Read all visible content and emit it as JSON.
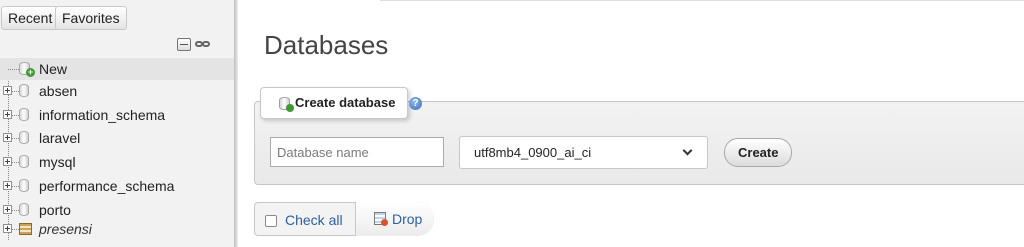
{
  "sidebar": {
    "tabs": {
      "recent": "Recent",
      "favorites": "Favorites"
    },
    "icons": [
      "collapse-all-icon",
      "link-icon"
    ],
    "new_item": "New",
    "databases": [
      {
        "label": "absen",
        "type": "database"
      },
      {
        "label": "information_schema",
        "type": "database"
      },
      {
        "label": "laravel",
        "type": "database"
      },
      {
        "label": "mysql",
        "type": "database"
      },
      {
        "label": "performance_schema",
        "type": "database"
      },
      {
        "label": "porto",
        "type": "database"
      },
      {
        "label": "presensi",
        "type": "database-italic"
      }
    ]
  },
  "main": {
    "title": "Databases",
    "create_panel": {
      "legend": "Create database",
      "name_placeholder": "Database name",
      "collation": "utf8mb4_0900_ai_ci",
      "create_label": "Create"
    },
    "actions": {
      "check_all": "Check all",
      "drop": "Drop"
    }
  },
  "colors": {
    "sidebar_bg": "#f2f2f2",
    "link_blue": "#2b5fa5",
    "panel_bg": "#ededed"
  }
}
